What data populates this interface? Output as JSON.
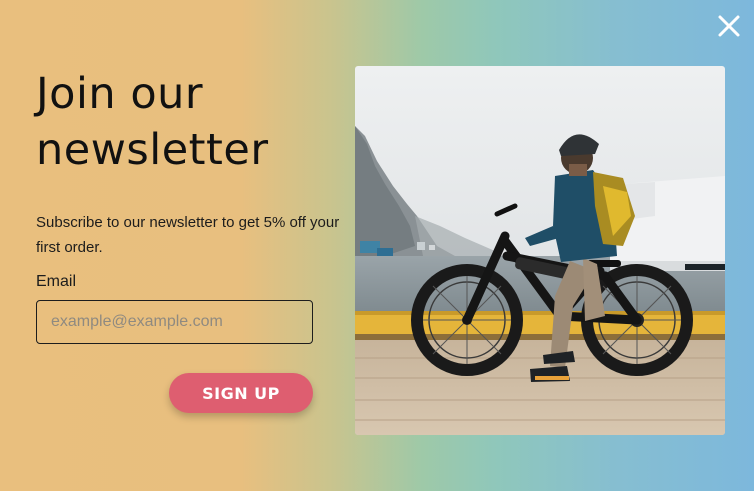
{
  "popup": {
    "close_icon": "close-icon",
    "headline_line1": "Join our",
    "headline_line2": "newsletter",
    "description": "Subscribe to our newsletter to get 5% off your first order.",
    "email_label": "Email",
    "email_placeholder": "example@example.com",
    "email_value": "",
    "signup_label": "SIGN UP",
    "colors": {
      "gradient_left": "#e9bf7e",
      "gradient_right": "#7db8dc",
      "button": "#de5e70"
    }
  },
  "photo": {
    "subject": "cyclist-on-e-bike-on-pier"
  }
}
